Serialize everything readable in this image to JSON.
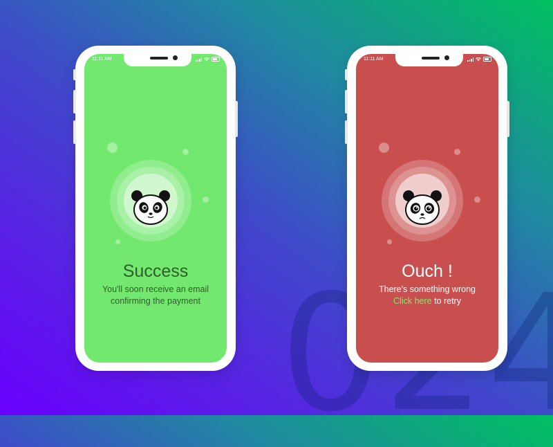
{
  "background": {
    "number": "024"
  },
  "colors": {
    "success": "#72e86e",
    "error": "#c94f4f",
    "success_text": "#2f5d2c",
    "link": "#8be66e"
  },
  "phones": {
    "success": {
      "time": "11:11 AM",
      "title": "Success",
      "message_line1": "You'll soon receive an email",
      "message_line2": "confirming the payment"
    },
    "error": {
      "time": "11:11 AM",
      "title": "Ouch !",
      "message_line1": "There's something wrong",
      "link": "Click here",
      "message_line2_suffix": " to retry"
    }
  },
  "icons": [
    "panda-happy-icon",
    "panda-sad-icon",
    "signal-icon",
    "wifi-icon",
    "battery-icon"
  ]
}
